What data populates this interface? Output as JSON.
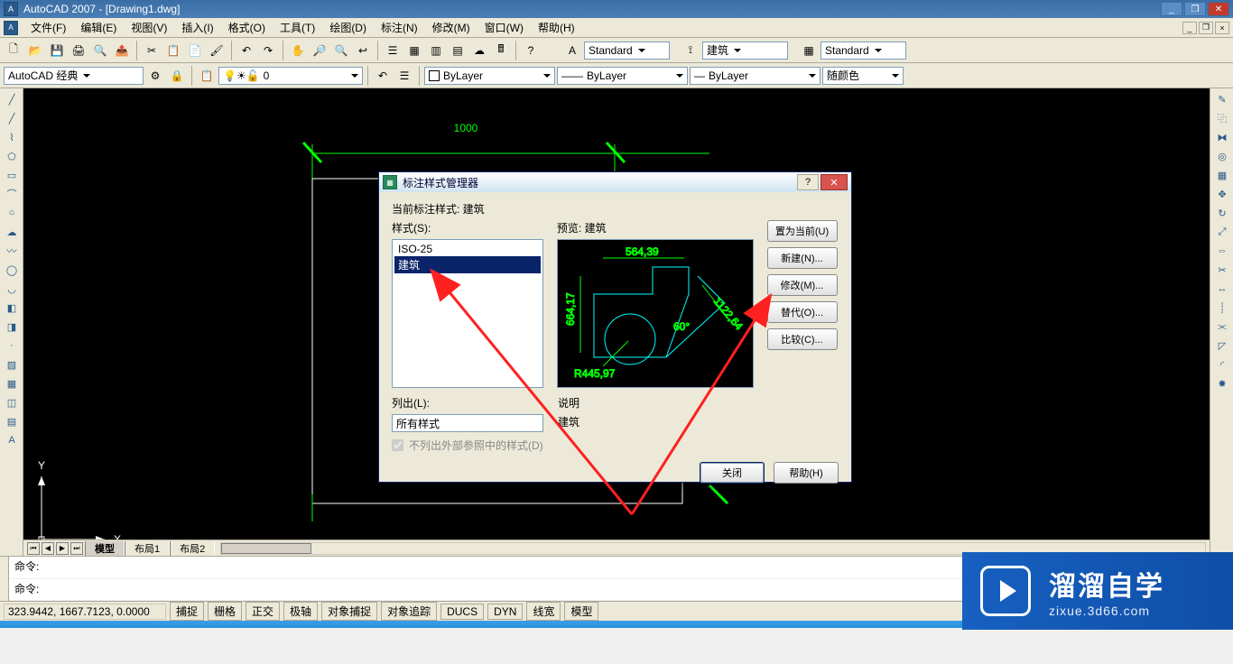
{
  "window": {
    "title": "AutoCAD 2007 - [Drawing1.dwg]",
    "min": "_",
    "max": "❐",
    "close": "✕"
  },
  "menubar": {
    "items": [
      {
        "label": "文件(F)"
      },
      {
        "label": "编辑(E)"
      },
      {
        "label": "视图(V)"
      },
      {
        "label": "插入(I)"
      },
      {
        "label": "格式(O)"
      },
      {
        "label": "工具(T)"
      },
      {
        "label": "绘图(D)"
      },
      {
        "label": "标注(N)"
      },
      {
        "label": "修改(M)"
      },
      {
        "label": "窗口(W)"
      },
      {
        "label": "帮助(H)"
      }
    ],
    "mdi": {
      "min": "_",
      "restore": "❐",
      "close": "×"
    }
  },
  "toolbar1": {
    "text_style_label": "Standard",
    "dim_style_label": "建筑",
    "table_style_label": "Standard"
  },
  "toolbar2": {
    "workspace": "AutoCAD 经典",
    "layer": "0",
    "linetype_label": "ByLayer",
    "lineweight_label": "ByLayer",
    "plotstyle_label": "ByLayer",
    "color_label": "随颜色"
  },
  "canvas": {
    "dim_text": "1000",
    "ucs": {
      "x": "X",
      "y": "Y"
    }
  },
  "tabs": {
    "nav_first": "⏮",
    "nav_prev": "◀",
    "nav_next": "▶",
    "nav_last": "⏭",
    "items": [
      {
        "label": "模型",
        "active": true
      },
      {
        "label": "布局1",
        "active": false
      },
      {
        "label": "布局2",
        "active": false
      }
    ]
  },
  "command": {
    "line1": "命令:",
    "line2": "命令:"
  },
  "statusbar": {
    "coords": "323.9442, 1667.7123, 0.0000",
    "toggles": [
      {
        "label": "捕捉"
      },
      {
        "label": "栅格"
      },
      {
        "label": "正交"
      },
      {
        "label": "极轴"
      },
      {
        "label": "对象捕捉"
      },
      {
        "label": "对象追踪"
      },
      {
        "label": "DUCS"
      },
      {
        "label": "DYN"
      },
      {
        "label": "线宽"
      },
      {
        "label": "模型"
      }
    ]
  },
  "dialog": {
    "title": "标注样式管理器",
    "help_btn": "?",
    "close_btn": "✕",
    "current_style_label": "当前标注样式:  建筑",
    "styles_label": "样式(S):",
    "preview_label": "预览:  建筑",
    "styles": [
      {
        "name": "ISO-25",
        "selected": false
      },
      {
        "name": "建筑",
        "selected": true
      }
    ],
    "list_label": "列出(L):",
    "list_value": "所有样式",
    "xref_check_label": "不列出外部参照中的样式(D)",
    "desc_label": "说明",
    "desc_value": "建筑",
    "buttons": {
      "set_current": "置为当前(U)",
      "new": "新建(N)...",
      "modify": "修改(M)...",
      "override": "替代(O)...",
      "compare": "比较(C)..."
    },
    "close": "关闭",
    "help": "帮助(H)",
    "preview": {
      "d1": "564,39",
      "d2": "664,17",
      "d3": "1122,64",
      "d4": "R445,97",
      "d5": "60°"
    }
  },
  "watermark": {
    "cn": "溜溜自学",
    "en": "zixue.3d66.com"
  }
}
